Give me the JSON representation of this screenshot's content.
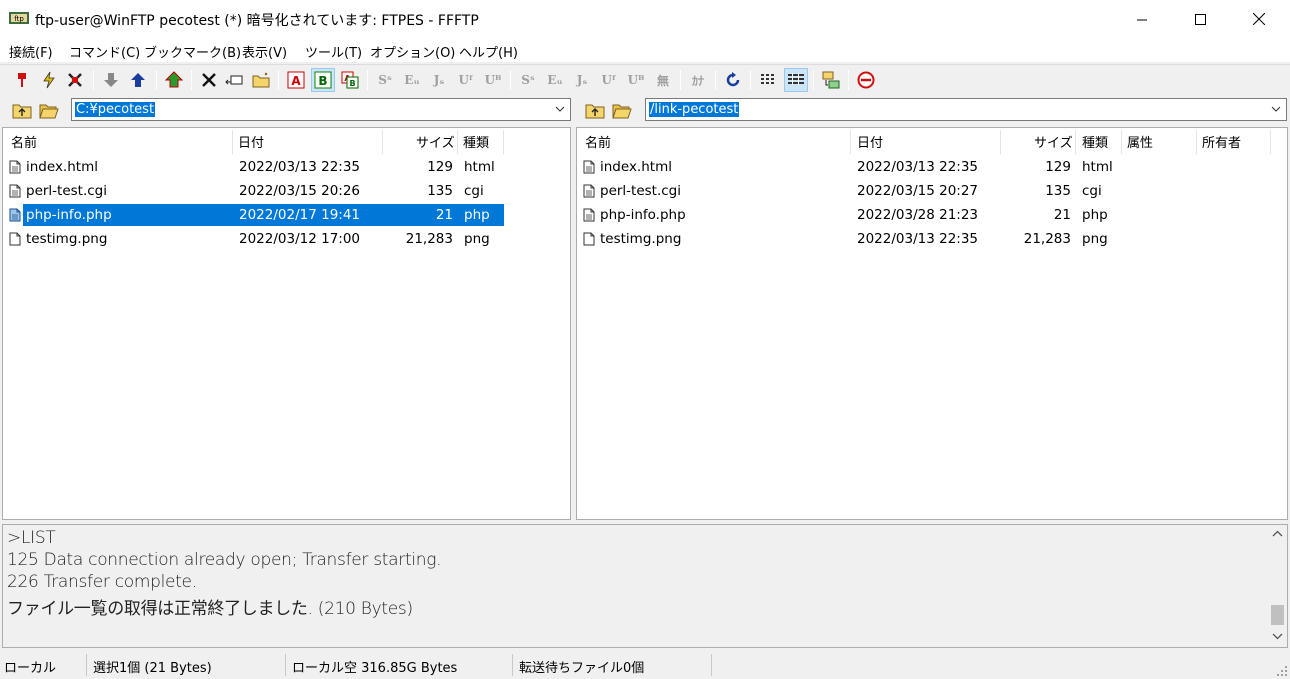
{
  "window": {
    "title": "ftp-user@WinFTP pecotest (*) 暗号化されています: FTPES - FFFTP"
  },
  "menu": [
    "接続(F)",
    "コマンド(C)",
    "ブックマーク(B)",
    "表示(V)",
    "ツール(T)",
    "オプション(O)",
    "ヘルプ(H)"
  ],
  "toolbar": {
    "icons": [
      "connect-icon",
      "quick-connect-icon",
      "disconnect-icon",
      "download-icon",
      "upload-icon",
      "mirror-upload-icon",
      "delete-icon",
      "rename-icon",
      "mkdir-icon",
      "ascii-mode-icon",
      "binary-mode-icon",
      "auto-mode-icon",
      "sjis-icon",
      "euc-icon",
      "jis-icon",
      "utf8-icon",
      "utf8bom-icon",
      "local-sjis-icon",
      "local-euc-icon",
      "local-jis-icon",
      "local-utf8-icon",
      "local-utf8bom-icon",
      "no-convert-icon",
      "kana-convert-icon",
      "refresh-icon",
      "list-view-icon",
      "detail-view-icon",
      "sync-folder-icon",
      "stop-icon"
    ],
    "labels": {
      "kana": "ｶﾅ",
      "none": "無"
    }
  },
  "local": {
    "path": "C:¥pecotest",
    "headers": {
      "name": "名前",
      "date": "日付",
      "size": "サイズ",
      "type": "種類"
    },
    "files": [
      {
        "name": "index.html",
        "date": "2022/03/13 22:35",
        "size": "129",
        "type": "html"
      },
      {
        "name": "perl-test.cgi",
        "date": "2022/03/15 20:26",
        "size": "135",
        "type": "cgi"
      },
      {
        "name": "php-info.php",
        "date": "2022/02/17 19:41",
        "size": "21",
        "type": "php"
      },
      {
        "name": "testimg.png",
        "date": "2022/03/12 17:00",
        "size": "21,283",
        "type": "png"
      }
    ]
  },
  "remote": {
    "path": "/link-pecotest",
    "headers": {
      "name": "名前",
      "date": "日付",
      "size": "サイズ",
      "type": "種類",
      "attr": "属性",
      "owner": "所有者"
    },
    "files": [
      {
        "name": "index.html",
        "date": "2022/03/13 22:35",
        "size": "129",
        "type": "html"
      },
      {
        "name": "perl-test.cgi",
        "date": "2022/03/15 20:27",
        "size": "135",
        "type": "cgi"
      },
      {
        "name": "php-info.php",
        "date": "2022/03/28 21:23",
        "size": "21",
        "type": "php"
      },
      {
        "name": "testimg.png",
        "date": "2022/03/13 22:35",
        "size": "21,283",
        "type": "png"
      }
    ]
  },
  "log": [
    ">LIST",
    "125 Data connection already open; Transfer starting.",
    "226 Transfer complete.",
    "ファイル一覧の取得は正常終了しました. (210 Bytes)"
  ],
  "status": {
    "mode": "ローカル",
    "selection": "選択1個 (21 Bytes)",
    "free": "ローカル空 316.85G Bytes",
    "queue": "転送待ちファイル0個"
  }
}
